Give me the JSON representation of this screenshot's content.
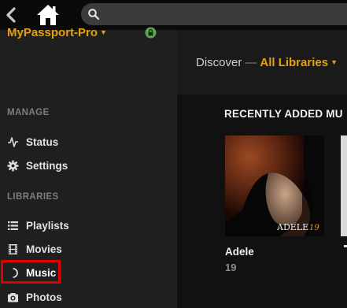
{
  "search": {
    "placeholder": ""
  },
  "sidebar": {
    "server_name": "MyPassport-Pro",
    "manage_header": "MANAGE",
    "manage_items": [
      {
        "label": "Status",
        "icon": "activity-icon"
      },
      {
        "label": "Settings",
        "icon": "gear-icon"
      }
    ],
    "libraries_header": "LIBRARIES",
    "library_items": [
      {
        "label": "Playlists",
        "icon": "list-icon"
      },
      {
        "label": "Movies",
        "icon": "film-icon"
      },
      {
        "label": "Music",
        "icon": "loading-spinner-icon"
      },
      {
        "label": "Photos",
        "icon": "camera-icon"
      }
    ]
  },
  "header": {
    "discover": "Discover",
    "separator": "—",
    "library": "All Libraries"
  },
  "main": {
    "section_title": "RECENTLY ADDED MU",
    "albums": [
      {
        "title": "Adele",
        "subtitle": "19",
        "cover_text": "ADELE",
        "cover_number": "19"
      }
    ]
  },
  "colors": {
    "accent": "#e5a00d",
    "highlight": "#e00000",
    "lock": "#4caf50"
  }
}
